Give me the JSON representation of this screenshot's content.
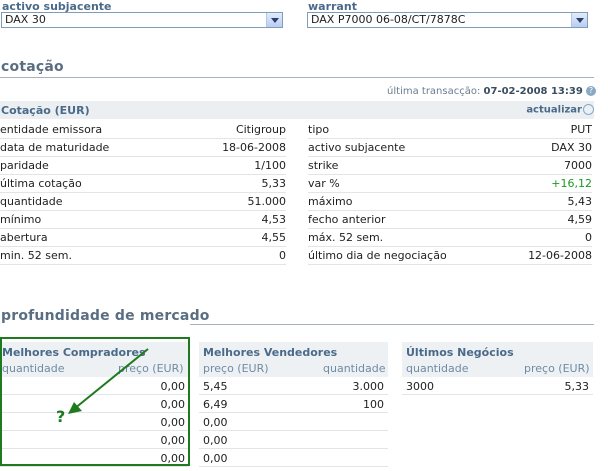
{
  "selectors": {
    "underlying_label": "activo subjacente",
    "underlying_value": "DAX 30",
    "warrant_label": "warrant",
    "warrant_value": "DAX P7000 06-08/CT/7878C"
  },
  "quote": {
    "section_title": "cotação",
    "last_trade_label": "última transacção:",
    "last_trade_value": "07-02-2008 13:39",
    "help_icon": "question-circle-icon",
    "table_title": "Cotação (EUR)",
    "refresh_label": "actualizar",
    "refresh_icon": "refresh-icon",
    "left_rows": [
      {
        "label": "entidade emissora",
        "value": "Citigroup"
      },
      {
        "label": "data de maturidade",
        "value": "18-06-2008"
      },
      {
        "label": "paridade",
        "value": "1/100"
      },
      {
        "label": "última cotação",
        "value": "5,33"
      },
      {
        "label": "quantidade",
        "value": "51.000"
      },
      {
        "label": "mínimo",
        "value": "4,53"
      },
      {
        "label": "abertura",
        "value": "4,55"
      },
      {
        "label": "min. 52 sem.",
        "value": "0"
      }
    ],
    "right_rows": [
      {
        "label": "tipo",
        "value": "PUT"
      },
      {
        "label": "activo subjacente",
        "value": "DAX 30"
      },
      {
        "label": "strike",
        "value": "7000"
      },
      {
        "label": "var %",
        "value": "+16,12"
      },
      {
        "label": "máximo",
        "value": "5,43"
      },
      {
        "label": "fecho anterior",
        "value": "4,59"
      },
      {
        "label": "máx. 52 sem.",
        "value": "0"
      },
      {
        "label": "último dia de negociação",
        "value": "12-06-2008"
      }
    ],
    "positive_color": "#1c9a1c"
  },
  "depth": {
    "section_title": "profundidade de mercado",
    "buyers": {
      "title": "Melhores Compradores",
      "col_qty": "quantidade",
      "col_price": "preço (EUR)",
      "rows": [
        {
          "qty": "",
          "price": "0,00"
        },
        {
          "qty": "",
          "price": "0,00"
        },
        {
          "qty": "",
          "price": "0,00"
        },
        {
          "qty": "",
          "price": "0,00"
        },
        {
          "qty": "",
          "price": "0,00"
        }
      ]
    },
    "sellers": {
      "title": "Melhores Vendedores",
      "col_price": "preço (EUR)",
      "col_qty": "quantidade",
      "rows": [
        {
          "price": "5,45",
          "qty": "3.000"
        },
        {
          "price": "6,49",
          "qty": "100"
        },
        {
          "price": "0,00",
          "qty": ""
        },
        {
          "price": "0,00",
          "qty": ""
        },
        {
          "price": "0,00",
          "qty": ""
        }
      ]
    },
    "trades": {
      "title": "Últimos Negócios",
      "col_qty": "quantidade",
      "col_price": "preço (EUR)",
      "rows": [
        {
          "qty": "3000",
          "price": "5,33"
        }
      ]
    },
    "annotation": {
      "mark": "?",
      "color": "#1f7a1f"
    }
  }
}
